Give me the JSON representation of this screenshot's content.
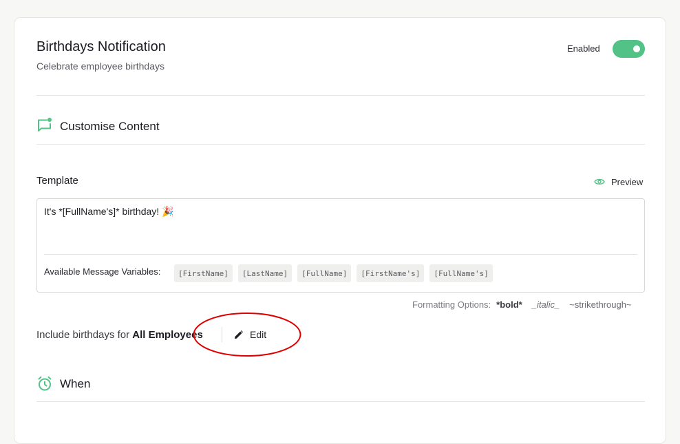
{
  "header": {
    "title": "Birthdays Notification",
    "subtitle": "Celebrate employee birthdays",
    "status_label": "Enabled",
    "toggle_on": true
  },
  "content_section": {
    "title": "Customise Content",
    "icon": "message-square-icon"
  },
  "template": {
    "label": "Template",
    "preview_label": "Preview",
    "message": "It's *[FullName's]* birthday! 🎉",
    "variables_label": "Available Message Variables:",
    "variables": [
      "[FirstName]",
      "[LastName]",
      "[FullName]",
      "[FirstName's]",
      "[FullName's]"
    ]
  },
  "formatting": {
    "label": "Formatting Options:",
    "bold": "*bold*",
    "italic": "_italic_",
    "strike": "~strikethrough~"
  },
  "include": {
    "prefix": "Include birthdays for",
    "value": "All Employees",
    "edit_label": "Edit"
  },
  "when_section": {
    "title": "When",
    "icon": "alarm-clock-icon"
  },
  "colors": {
    "accent": "#52c287",
    "annotation": "#e00000"
  }
}
